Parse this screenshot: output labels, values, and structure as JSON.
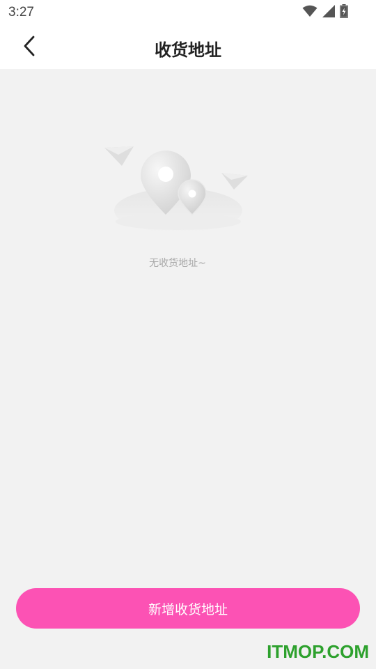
{
  "status_bar": {
    "time": "3:27",
    "icons": [
      "wifi-icon",
      "signal-icon",
      "battery-charging-icon"
    ]
  },
  "header": {
    "title": "收货地址",
    "back_icon": "chevron-left-icon"
  },
  "empty_state": {
    "icon": "location-pin-illustration",
    "message": "无收货地址~"
  },
  "footer": {
    "add_button_label": "新增收货地址"
  },
  "watermark": {
    "text": "ITMOP.COM"
  },
  "colors": {
    "accent": "#fc52b4",
    "background": "#f2f2f2",
    "header_bg": "#ffffff",
    "title_text": "#222222",
    "empty_text": "#a8a8a8",
    "watermark": "#2da12d"
  }
}
